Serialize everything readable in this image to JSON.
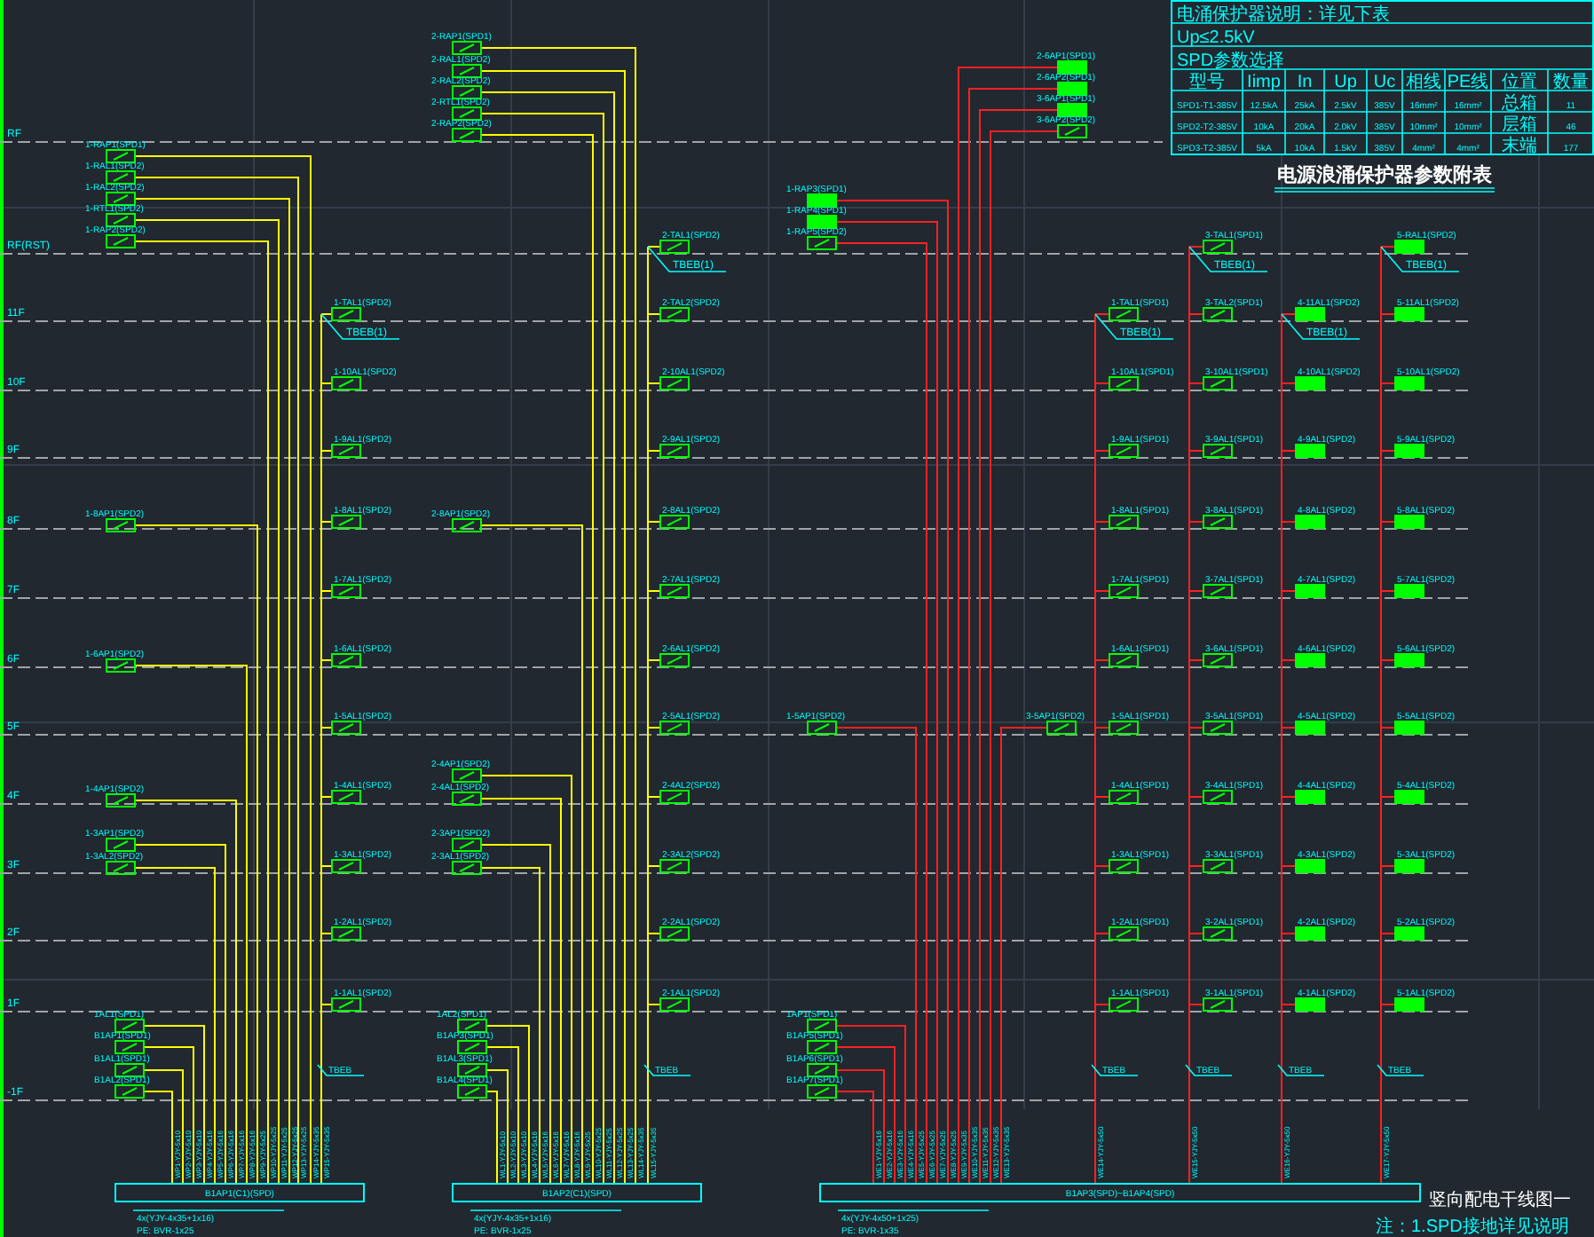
{
  "floors": [
    "RF",
    "RF(RST)",
    "11F",
    "10F",
    "9F",
    "8F",
    "7F",
    "6F",
    "5F",
    "4F",
    "3F",
    "2F",
    "1F",
    "-1F"
  ],
  "table": {
    "lines": [
      "电涌保护器说明：详见下表",
      "Up≤2.5kV",
      "SPD参数选择"
    ],
    "columns": [
      "型号",
      "Iimp",
      "In",
      "Up",
      "Uc",
      "相线",
      "PE线",
      "位置",
      "数量"
    ],
    "rows": [
      [
        "SPD1-T1-385V",
        "12.5kA",
        "25kA",
        "2.5kV",
        "385V",
        "16mm²",
        "16mm²",
        "总箱",
        "11"
      ],
      [
        "SPD2-T2-385V",
        "10kA",
        "20kA",
        "2.0kV",
        "385V",
        "10mm²",
        "10mm²",
        "层箱",
        "46"
      ],
      [
        "SPD3-T2-385V",
        "5kA",
        "10kA",
        "1.5kV",
        "385V",
        "4mm²",
        "4mm²",
        "末端",
        "177"
      ]
    ],
    "caption": "电源浪涌保护器参数附表"
  },
  "systems": [
    {
      "color": "#ffff00",
      "bus": "B1AP1(C1)(SPD)",
      "breakers": [
        {
          "label": "1-RAP1(SPD1)",
          "kind": "switch"
        },
        {
          "label": "1-RAL1(SPD2)",
          "kind": "switch"
        },
        {
          "label": "1-RAL2(SPD2)",
          "kind": "switch"
        },
        {
          "label": "1-RTL1(SPD2)",
          "kind": "switch"
        },
        {
          "label": "1-RAP2(SPD2)",
          "kind": "switch"
        },
        {
          "label": "1-8AP1(SPD2)",
          "kind": "switch"
        },
        {
          "label": "1-6AP1(SPD2)",
          "kind": "switch"
        },
        {
          "label": "1-4AP1(SPD2)",
          "kind": "switch"
        },
        {
          "label": "1-3AP1(SPD2)",
          "kind": "switch"
        },
        {
          "label": "1-3AL2(SPD2)",
          "kind": "switch"
        },
        {
          "label": "1AL1(SPD1)",
          "kind": "switch"
        },
        {
          "label": "B1AP1(SPD1)",
          "kind": "switch"
        },
        {
          "label": "B1AL1(SPD1)",
          "kind": "switch"
        },
        {
          "label": "B1AL2(SPD1)",
          "kind": "switch"
        }
      ],
      "columns": [
        {
          "note": "TBEB(1)",
          "bottom_note": "TBEB",
          "breakers": [
            {
              "label": "1-TAL1(SPD2)",
              "kind": "switch"
            },
            {
              "label": "1-10AL1(SPD2)",
              "kind": "switch"
            },
            {
              "label": "1-9AL1(SPD2)",
              "kind": "switch"
            },
            {
              "label": "1-8AL1(SPD2)",
              "kind": "switch"
            },
            {
              "label": "1-7AL1(SPD2)",
              "kind": "switch"
            },
            {
              "label": "1-6AL1(SPD2)",
              "kind": "switch"
            },
            {
              "label": "1-5AL1(SPD2)",
              "kind": "switch"
            },
            {
              "label": "1-4AL1(SPD2)",
              "kind": "switch"
            },
            {
              "label": "1-3AL1(SPD2)",
              "kind": "switch"
            },
            {
              "label": "1-2AL1(SPD2)",
              "kind": "switch"
            },
            {
              "label": "1-1AL1(SPD2)",
              "kind": "switch"
            }
          ]
        }
      ],
      "cable_labels": [
        "WP1-YJY-5x10",
        "WP2-YJY-5x10",
        "WP3-YJY-5x10",
        "WP4-YJY-5x16",
        "WP5-YJY-5x16",
        "WP6-YJY-5x16",
        "WP7-YJY-5x16",
        "WP8-YJY-5x16",
        "WP9-YJY-5x25",
        "WP10-YJY-5x25",
        "WP11-YJY-5x25",
        "WP12-YJY-5x25",
        "WP13-YJY-5x25",
        "WP14-YJY-5x35",
        "WP15-YJY-5x35"
      ],
      "notes": [
        "4x(YJY-4x35+1x16)",
        "PE: BVR-1x25"
      ]
    },
    {
      "color": "#ffff00",
      "bus": "B1AP2(C1)(SPD)",
      "breakers": [
        {
          "label": "2-RAP1(SPD1)",
          "kind": "switch"
        },
        {
          "label": "2-RAL1(SPD2)",
          "kind": "switch"
        },
        {
          "label": "2-RAL2(SPD2)",
          "kind": "switch"
        },
        {
          "label": "2-RTL1(SPD2)",
          "kind": "switch"
        },
        {
          "label": "2-RAP2(SPD2)",
          "kind": "switch"
        },
        {
          "label": "2-8AP1(SPD2)",
          "kind": "switch"
        },
        {
          "label": "2-4AP1(SPD2)",
          "kind": "switch"
        },
        {
          "label": "2-4AL1(SPD2)",
          "kind": "switch"
        },
        {
          "label": "2-3AP1(SPD2)",
          "kind": "switch"
        },
        {
          "label": "2-3AL1(SPD2)",
          "kind": "switch"
        },
        {
          "label": "1AL2(SPD1)",
          "kind": "switch"
        },
        {
          "label": "B1AP3(SPD1)",
          "kind": "switch"
        },
        {
          "label": "B1AL3(SPD1)",
          "kind": "switch"
        },
        {
          "label": "B1AL4(SPD1)",
          "kind": "switch"
        }
      ],
      "columns": [
        {
          "note": "TBEB(1)",
          "bottom_note": "TBEB",
          "breakers": [
            {
              "label": "2-TAL1(SPD2)",
              "kind": "switch"
            },
            {
              "label": "2-TAL2(SPD2)",
              "kind": "switch"
            },
            {
              "label": "2-10AL1(SPD2)",
              "kind": "switch"
            },
            {
              "label": "2-9AL1(SPD2)",
              "kind": "switch"
            },
            {
              "label": "2-8AL1(SPD2)",
              "kind": "switch"
            },
            {
              "label": "2-7AL1(SPD2)",
              "kind": "switch"
            },
            {
              "label": "2-6AL1(SPD2)",
              "kind": "switch"
            },
            {
              "label": "2-5AL1(SPD2)",
              "kind": "switch"
            },
            {
              "label": "2-4AL2(SPD2)",
              "kind": "switch"
            },
            {
              "label": "2-3AL2(SPD2)",
              "kind": "switch"
            },
            {
              "label": "2-2AL1(SPD2)",
              "kind": "switch"
            },
            {
              "label": "2-1AL1(SPD2)",
              "kind": "switch"
            }
          ]
        }
      ],
      "cable_labels": [
        "WL1-YJY-5x10",
        "WL2-YJY-5x10",
        "WL3-YJY-5x10",
        "WL4-YJY-5x16",
        "WL5-YJY-5x16",
        "WL6-YJY-5x16",
        "WL7-YJY-5x16",
        "WL8-YJY-5x16",
        "WL9-YJY-5x25",
        "WL10-YJY-5x25",
        "WL11-YJY-5x25",
        "WL12-YJY-5x25",
        "WL13-YJY-5x25",
        "WL14-YJY-5x35",
        "WL15-YJY-5x35"
      ],
      "notes": [
        "4x(YJY-4x35+1x16)",
        "PE: BVR-1x25"
      ]
    },
    {
      "color": "#ff2020",
      "bus": "B1AP3(SPD)~B1AP4(SPD)",
      "breakers": [
        {
          "label": "2-6AP1(SPD1)",
          "kind": "solid"
        },
        {
          "label": "2-6AP2(SPD1)",
          "kind": "solid"
        },
        {
          "label": "3-6AP1(SPD1)",
          "kind": "solid"
        },
        {
          "label": "3-6AP2(SPD2)",
          "kind": "switch"
        },
        {
          "label": "1-RAP3(SPD1)",
          "kind": "solid"
        },
        {
          "label": "1-RAP4(SPD1)",
          "kind": "solid"
        },
        {
          "label": "1-RAP5(SPD2)",
          "kind": "switch"
        },
        {
          "label": "1-5AP1(SPD2)",
          "kind": "switch"
        },
        {
          "label": "3-5AP1(SPD2)",
          "kind": "switch"
        },
        {
          "label": "1AP1(SPD1)",
          "kind": "switch"
        },
        {
          "label": "B1AP5(SPD1)",
          "kind": "switch"
        },
        {
          "label": "B1AP6(SPD1)",
          "kind": "switch"
        },
        {
          "label": "B1AP7(SPD1)",
          "kind": "switch"
        }
      ],
      "columns": [
        {
          "note": "TBEB(1)",
          "bottom_note": "TBEB",
          "breakers": [
            {
              "label": "1-TAL1(SPD1)",
              "kind": "switch"
            },
            {
              "label": "1-10AL1(SPD1)",
              "kind": "switch"
            },
            {
              "label": "1-9AL1(SPD1)",
              "kind": "switch"
            },
            {
              "label": "1-8AL1(SPD1)",
              "kind": "switch"
            },
            {
              "label": "1-7AL1(SPD1)",
              "kind": "switch"
            },
            {
              "label": "1-6AL1(SPD1)",
              "kind": "switch"
            },
            {
              "label": "1-5AL1(SPD1)",
              "kind": "switch"
            },
            {
              "label": "1-4AL1(SPD1)",
              "kind": "switch"
            },
            {
              "label": "1-3AL1(SPD1)",
              "kind": "switch"
            },
            {
              "label": "1-2AL1(SPD1)",
              "kind": "switch"
            },
            {
              "label": "1-1AL1(SPD1)",
              "kind": "switch"
            }
          ]
        },
        {
          "note": "TBEB(1)",
          "bottom_note": "TBEB",
          "breakers": [
            {
              "label": "3-TAL1(SPD1)",
              "kind": "switch"
            },
            {
              "label": "3-TAL2(SPD1)",
              "kind": "switch"
            },
            {
              "label": "3-10AL1(SPD1)",
              "kind": "switch"
            },
            {
              "label": "3-9AL1(SPD1)",
              "kind": "switch"
            },
            {
              "label": "3-8AL1(SPD1)",
              "kind": "switch"
            },
            {
              "label": "3-7AL1(SPD1)",
              "kind": "switch"
            },
            {
              "label": "3-6AL1(SPD1)",
              "kind": "switch"
            },
            {
              "label": "3-5AL1(SPD1)",
              "kind": "switch"
            },
            {
              "label": "3-4AL1(SPD1)",
              "kind": "switch"
            },
            {
              "label": "3-3AL1(SPD1)",
              "kind": "switch"
            },
            {
              "label": "3-2AL1(SPD1)",
              "kind": "switch"
            },
            {
              "label": "3-1AL1(SPD1)",
              "kind": "switch"
            }
          ]
        },
        {
          "note": "TBEB(1)",
          "bottom_note": "TBEB",
          "breakers": [
            {
              "label": "4-11AL1(SPD2)",
              "kind": "solid"
            },
            {
              "label": "4-10AL1(SPD2)",
              "kind": "solid"
            },
            {
              "label": "4-9AL1(SPD2)",
              "kind": "solid"
            },
            {
              "label": "4-8AL1(SPD2)",
              "kind": "solid"
            },
            {
              "label": "4-7AL1(SPD2)",
              "kind": "solid"
            },
            {
              "label": "4-6AL1(SPD2)",
              "kind": "solid"
            },
            {
              "label": "4-5AL1(SPD2)",
              "kind": "solid"
            },
            {
              "label": "4-4AL1(SPD2)",
              "kind": "solid"
            },
            {
              "label": "4-3AL1(SPD2)",
              "kind": "solid"
            },
            {
              "label": "4-2AL1(SPD2)",
              "kind": "solid"
            },
            {
              "label": "4-1AL1(SPD2)",
              "kind": "solid"
            }
          ]
        },
        {
          "note": "TBEB(1)",
          "bottom_note": "TBEB",
          "breakers": [
            {
              "label": "5-RAL1(SPD2)",
              "kind": "solid"
            },
            {
              "label": "5-11AL1(SPD2)",
              "kind": "solid"
            },
            {
              "label": "5-10AL1(SPD2)",
              "kind": "solid"
            },
            {
              "label": "5-9AL1(SPD2)",
              "kind": "solid"
            },
            {
              "label": "5-8AL1(SPD2)",
              "kind": "solid"
            },
            {
              "label": "5-7AL1(SPD2)",
              "kind": "solid"
            },
            {
              "label": "5-6AL1(SPD2)",
              "kind": "solid"
            },
            {
              "label": "5-5AL1(SPD2)",
              "kind": "solid"
            },
            {
              "label": "5-4AL1(SPD2)",
              "kind": "solid"
            },
            {
              "label": "5-3AL1(SPD2)",
              "kind": "solid"
            },
            {
              "label": "5-2AL1(SPD2)",
              "kind": "solid"
            },
            {
              "label": "5-1AL1(SPD2)",
              "kind": "solid"
            }
          ]
        }
      ],
      "cable_labels": [
        "WE1-YJY-5x16",
        "WE2-YJY-5x16",
        "WE3-YJY-5x16",
        "WE4-YJY-5x16",
        "WE5-YJY-5x25",
        "WE6-YJY-5x25",
        "WE7-YJY-5x25",
        "WE8-YJY-5x25",
        "WE9-YJY-5x35",
        "WE10-YJY-5x35",
        "WE11-YJY-5x35",
        "WE12-YJY-5x35",
        "WE13-YJY-5x35",
        "WE14-YJY-5x50",
        "WE15-YJY-5x50",
        "WE16-YJY-5x50",
        "WE17-YJY-5x50"
      ],
      "notes": [
        "4x(YJY-4x50+1x25)",
        "PE: BVR-1x35"
      ]
    }
  ],
  "title": "竖向配电干线图一",
  "footnote": "注：1.SPD接地详见说明"
}
